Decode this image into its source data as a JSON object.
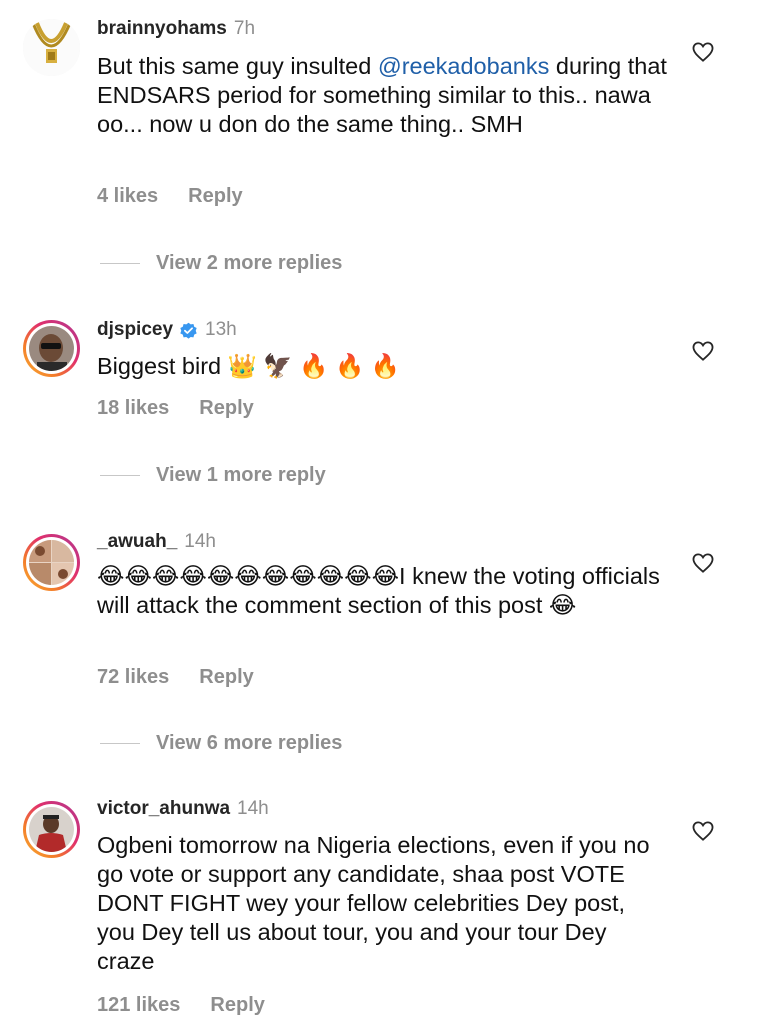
{
  "comments": [
    {
      "username": "brainnyohams",
      "time": "7h",
      "text_before": "But this same guy insulted ",
      "mention": "@reekadobanks",
      "text_after": " during that ENDSARS period for something similar to this.. nawa oo... now u don do the same thing.. SMH",
      "likes": "4 likes",
      "reply": "Reply",
      "view_more": "View 2 more replies",
      "verified": false,
      "avatar_icon": "gold-chain-avatar"
    },
    {
      "username": "djspicey",
      "time": "13h",
      "text": "Biggest bird 👑 🦅 🔥 🔥 🔥",
      "likes": "18 likes",
      "reply": "Reply",
      "view_more": "View 1 more reply",
      "verified": true,
      "avatar_icon": "person-sunglasses-avatar"
    },
    {
      "username": "_awuah_",
      "time": "14h",
      "text": "😂😂😂😂😂😂😂😂😂😂😂I knew the voting officials will attack the comment section of this post 😂",
      "likes": "72 likes",
      "reply": "Reply",
      "view_more": "View 6 more replies",
      "verified": false,
      "avatar_icon": "collage-avatar"
    },
    {
      "username": "victor_ahunwa",
      "time": "14h",
      "text": "Ogbeni tomorrow na Nigeria elections, even if you no go vote or support any candidate, shaa post VOTE DONT FIGHT wey your fellow celebrities Dey post, you Dey tell us about tour, you and your tour Dey craze",
      "likes": "121 likes",
      "reply": "Reply",
      "verified": false,
      "avatar_icon": "person-red-shirt-avatar"
    }
  ],
  "colors": {
    "username": "#262626",
    "secondary": "#8e8e8e",
    "mention": "#1f5fa8",
    "verified": "#3897f0"
  }
}
